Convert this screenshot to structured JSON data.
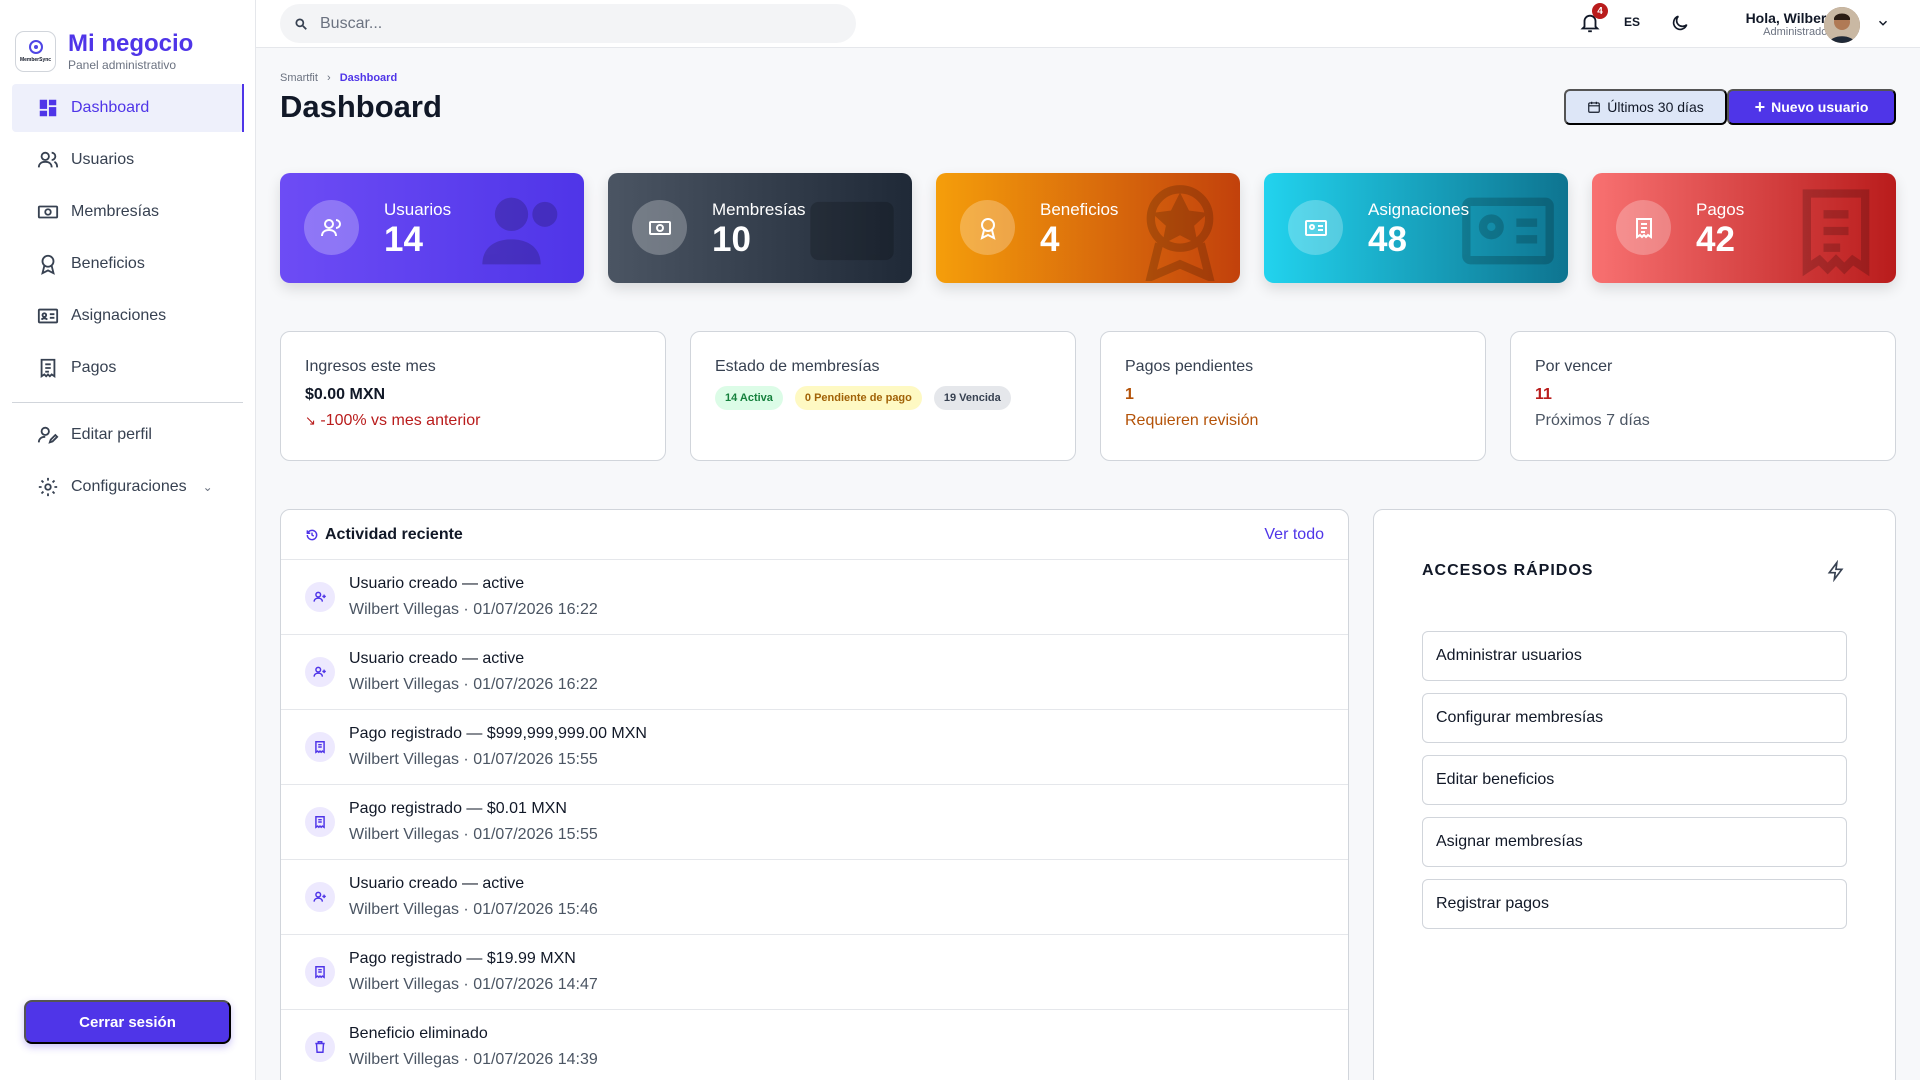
{
  "brand": {
    "title": "Mi negocio",
    "subtitle": "Panel administrativo",
    "logo_text": "MemberSync"
  },
  "sidebar": {
    "items": [
      {
        "label": "Dashboard",
        "icon": "grid-icon",
        "active": true
      },
      {
        "label": "Usuarios",
        "icon": "users-icon"
      },
      {
        "label": "Membresías",
        "icon": "cash-icon"
      },
      {
        "label": "Beneficios",
        "icon": "award-icon"
      },
      {
        "label": "Asignaciones",
        "icon": "id-card-icon"
      },
      {
        "label": "Pagos",
        "icon": "receipt-icon"
      },
      {
        "label": "Editar perfil",
        "icon": "user-edit-icon"
      },
      {
        "label": "Configuraciones",
        "icon": "gear-icon"
      }
    ],
    "logout_label": "Cerrar sesión"
  },
  "topbar": {
    "search_placeholder": "Buscar...",
    "notif_count": "4",
    "lang": "ES",
    "greeting": "Hola, Wilbert",
    "role": "Administrador"
  },
  "breadcrumb": {
    "root": "Smartfit",
    "sep": "›",
    "current": "Dashboard"
  },
  "page_title": "Dashboard",
  "actions": {
    "range_label": "Últimos 30 días",
    "new_user_label": "Nuevo usuario"
  },
  "stats": [
    {
      "label": "Usuarios",
      "value": "14"
    },
    {
      "label": "Membresías",
      "value": "10"
    },
    {
      "label": "Beneficios",
      "value": "4"
    },
    {
      "label": "Asignaciones",
      "value": "48"
    },
    {
      "label": "Pagos",
      "value": "42"
    }
  ],
  "info": {
    "income": {
      "title": "Ingresos este mes",
      "value": "$0.00 MXN",
      "note": "-100% vs mes anterior"
    },
    "memberships": {
      "title": "Estado de membresías",
      "active": "14 Activa",
      "pending": "0 Pendiente de pago",
      "expired": "19 Vencida"
    },
    "pending": {
      "title": "Pagos pendientes",
      "value": "1",
      "note": "Requieren revisión"
    },
    "expiring": {
      "title": "Por vencer",
      "value": "11",
      "note": "Próximos 7 días"
    }
  },
  "activity": {
    "title": "Actividad reciente",
    "link": "Ver todo",
    "rows": [
      {
        "type": "user",
        "main": "Usuario creado — active",
        "sub": "Wilbert Villegas · 01/07/2026 16:22"
      },
      {
        "type": "user",
        "main": "Usuario creado — active",
        "sub": "Wilbert Villegas · 01/07/2026 16:22"
      },
      {
        "type": "payment",
        "main": "Pago registrado — $999,999,999.00 MXN",
        "sub": "Wilbert Villegas · 01/07/2026 15:55"
      },
      {
        "type": "payment",
        "main": "Pago registrado — $0.01 MXN",
        "sub": "Wilbert Villegas · 01/07/2026 15:55"
      },
      {
        "type": "user",
        "main": "Usuario creado — active",
        "sub": "Wilbert Villegas · 01/07/2026 15:46"
      },
      {
        "type": "payment",
        "main": "Pago registrado — $19.99 MXN",
        "sub": "Wilbert Villegas · 01/07/2026 14:47"
      },
      {
        "type": "trash",
        "main": "Beneficio eliminado",
        "sub": "Wilbert Villegas · 01/07/2026 14:39"
      }
    ]
  },
  "quick": {
    "title": "ACCESOS RÁPIDOS",
    "items": [
      "Administrar usuarios",
      "Configurar membresías",
      "Editar beneficios",
      "Asignar membresías",
      "Registrar pagos"
    ]
  },
  "colors": {
    "accent": "#4f35e8",
    "danger": "#b91c1c",
    "warning": "#b45309"
  }
}
